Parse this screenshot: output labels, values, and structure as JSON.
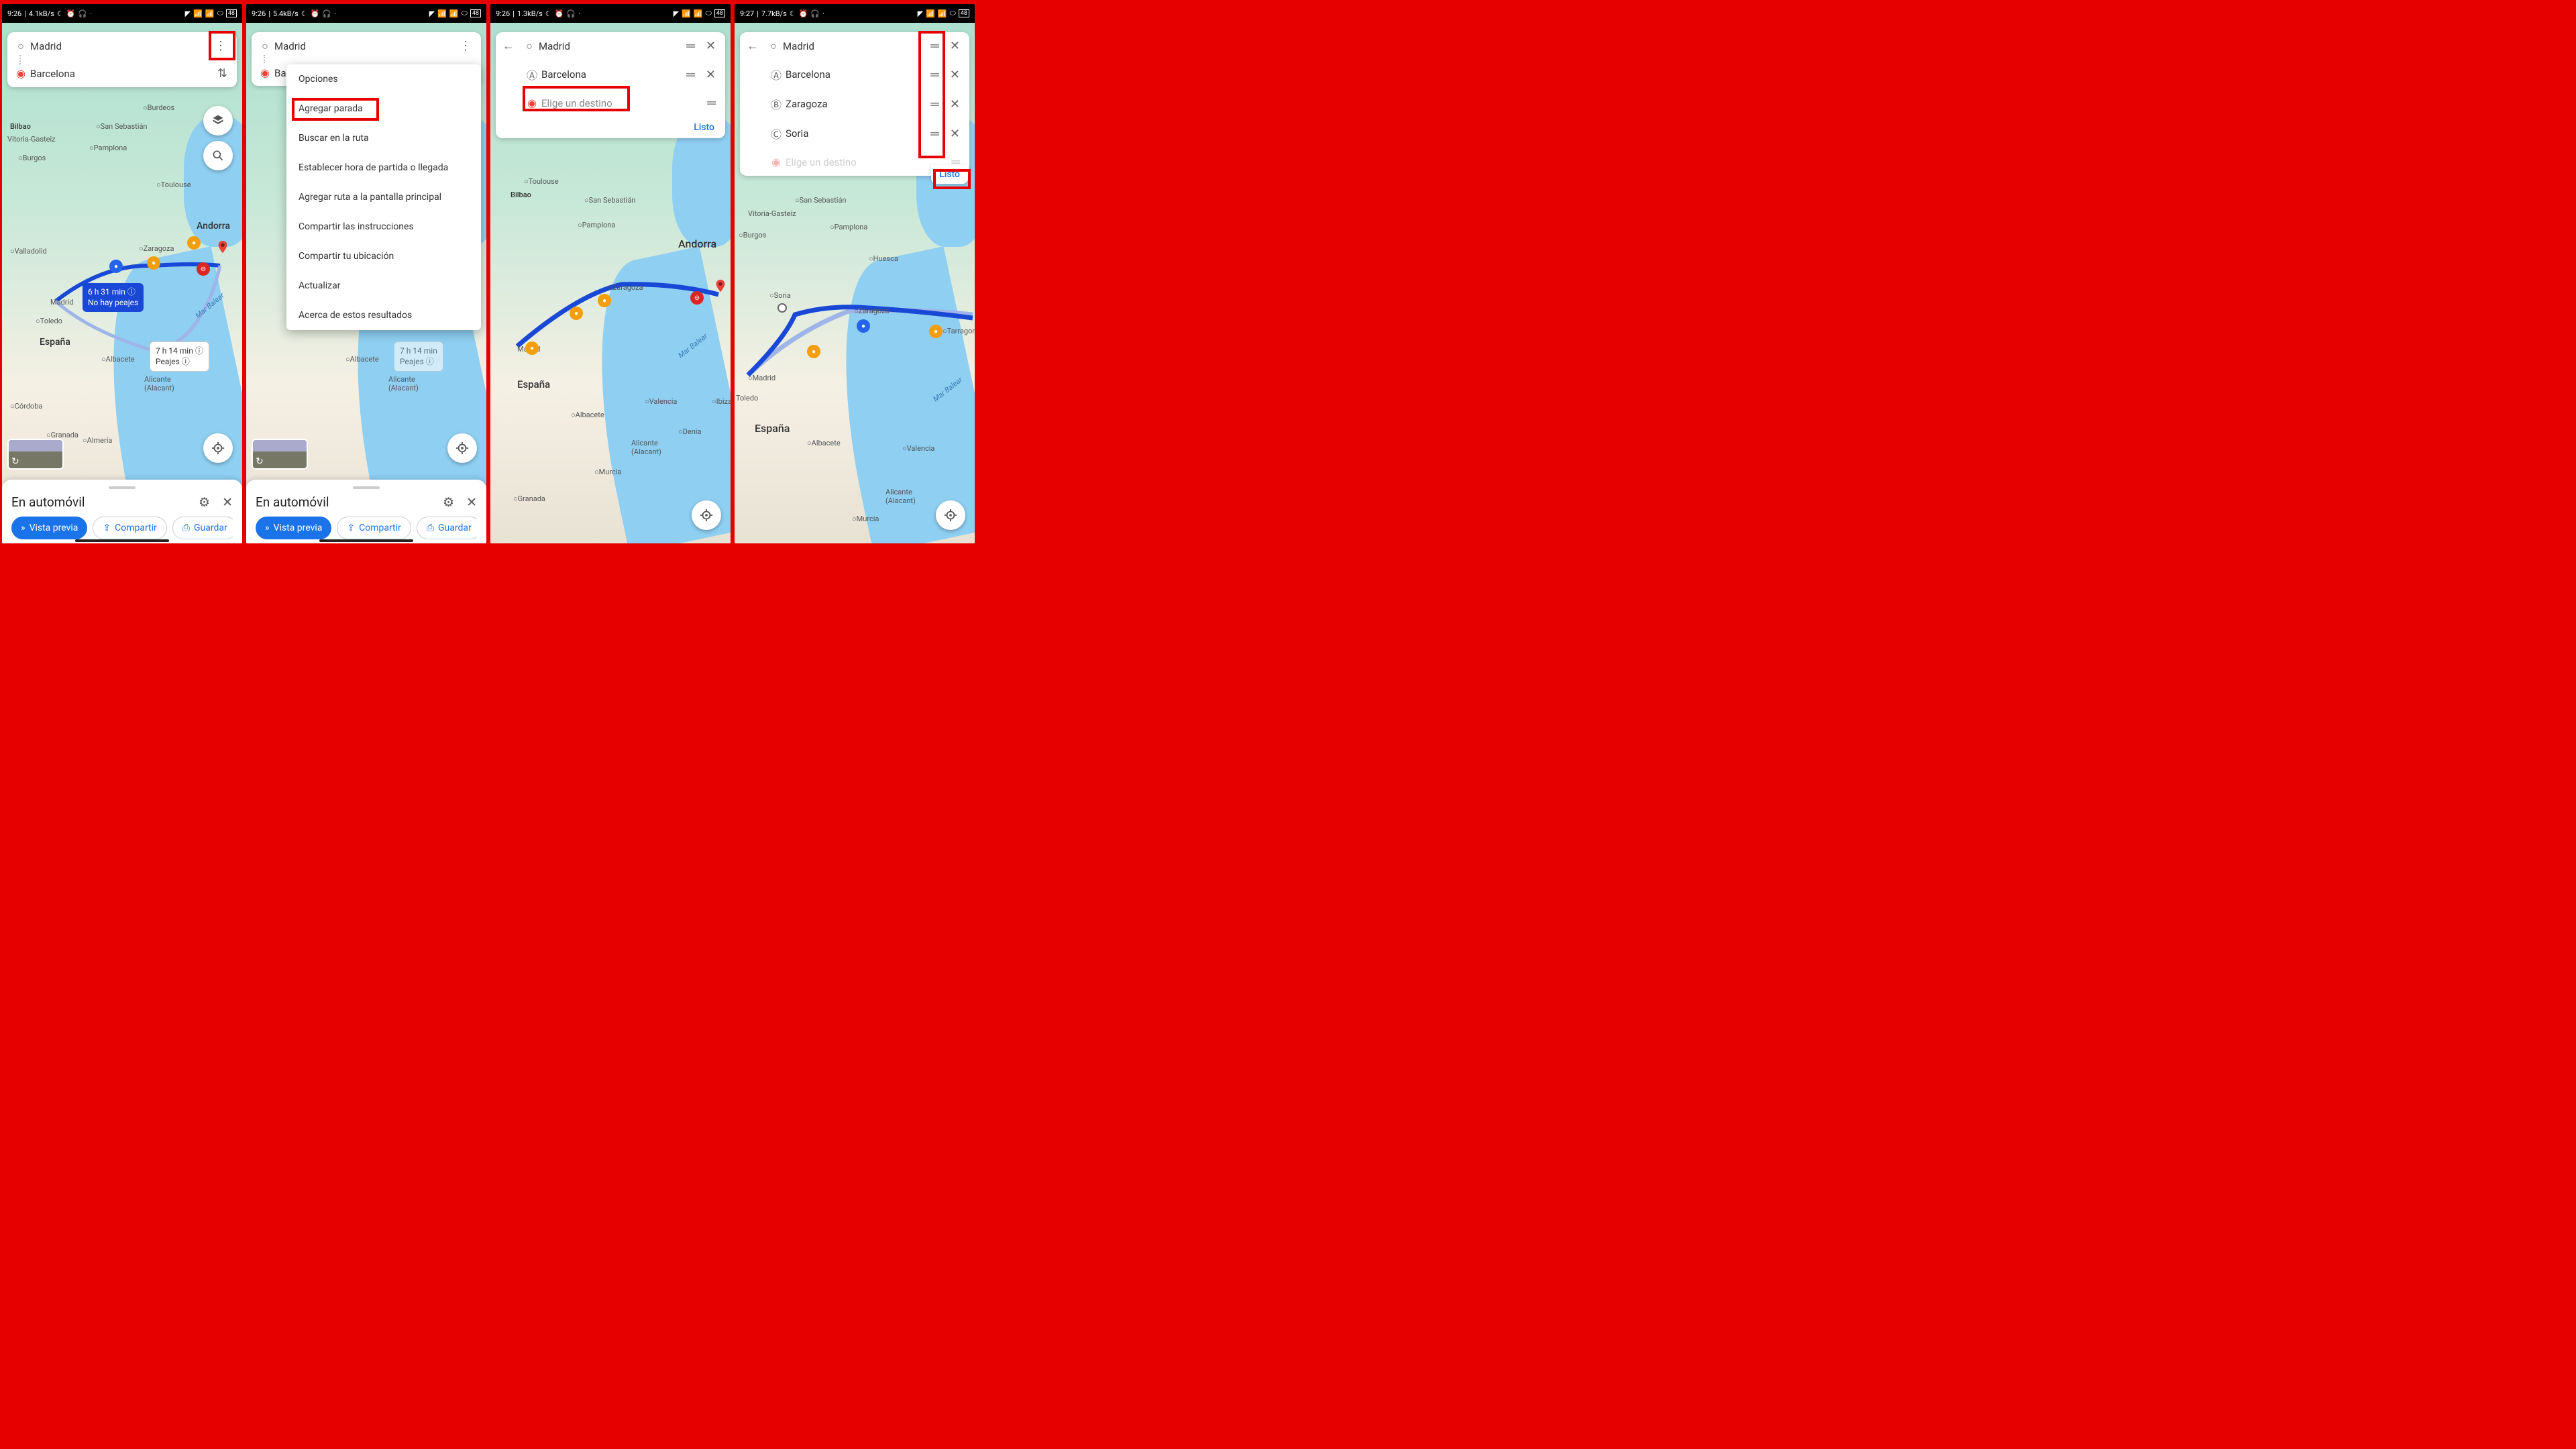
{
  "status": [
    {
      "time": "9:26",
      "net": "4.1kB/s",
      "batt": "48"
    },
    {
      "time": "9:26",
      "net": "5.4kB/s",
      "batt": "48"
    },
    {
      "time": "9:26",
      "net": "1.3kB/s",
      "batt": "48"
    },
    {
      "time": "9:27",
      "net": "7.7kB/s",
      "batt": "48"
    }
  ],
  "s1": {
    "origin": "Madrid",
    "dest": "Barcelona",
    "c1_l1": "6 h 31 min",
    "c1_l2": "No hay peajes",
    "c2_l1": "7 h 14 min",
    "c2_l2": "Peajes",
    "sheet_title": "En automóvil",
    "chip_preview": "Vista previa",
    "chip_share": "Compartir",
    "chip_save": "Guardar"
  },
  "s2": {
    "origin": "Madrid",
    "dest": "Barcelona",
    "menu": [
      "Opciones",
      "Agregar parada",
      "Buscar en la ruta",
      "Establecer hora de partida o llegada",
      "Agregar ruta a la pantalla principal",
      "Compartir las instrucciones",
      "Compartir tu ubicación",
      "Actualizar",
      "Acerca de estos resultados"
    ],
    "c2_l1": "7 h 14 min",
    "c2_l2": "Peajes",
    "sheet_title": "En automóvil",
    "chip_preview": "Vista previa",
    "chip_share": "Compartir",
    "chip_save": "Guardar"
  },
  "s3": {
    "origin": "Madrid",
    "a": "Barcelona",
    "choose": "Elige un destino",
    "done": "Listo"
  },
  "s4": {
    "origin": "Madrid",
    "a": "Barcelona",
    "b": "Zaragoza",
    "c": "Soria",
    "choose": "Elige un destino",
    "done": "Listo"
  },
  "places": {
    "andorra": "Andorra",
    "espana": "España",
    "madrid": "Madrid",
    "barcelona": "Barcelona",
    "zaragoza": "Zaragoza",
    "valencia": "Valencia",
    "bilbao": "Bilbao",
    "toledo": "Toledo",
    "murcia": "Murcia",
    "alicante": "Alicante",
    "alacant": "(Alacant)",
    "burgos": "Burgos",
    "pamplona": "Pamplona",
    "sansebastian": "San Sebastián",
    "vitoria": "Vitoria-Gasteiz",
    "valladolid": "Valladolid",
    "albacete": "Albacete",
    "cordoba": "Córdoba",
    "granada": "Granada",
    "almeria": "Almería",
    "ibiza": "Ibiza",
    "denia": "Denia",
    "bordeaux": "Burdeos",
    "toulouse": "Toulouse",
    "tarragona": "Tarragona",
    "huesca": "Huesca",
    "soria": "Soria",
    "marbalear": "Mar Balear",
    "tar": "tar"
  }
}
